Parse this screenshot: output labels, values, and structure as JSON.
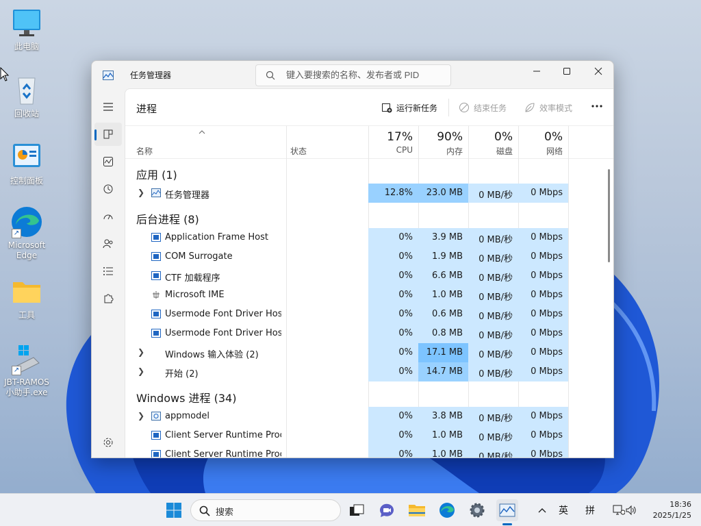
{
  "desktop": {
    "icons": [
      {
        "label": "此电脑"
      },
      {
        "label": "回收站"
      },
      {
        "label": "控制面板"
      },
      {
        "label": "Microsoft Edge"
      },
      {
        "label": "工具"
      },
      {
        "label": "JBT-RAMOS小助手.exe"
      }
    ]
  },
  "window": {
    "title": "任务管理器",
    "search_placeholder": "键入要搜索的名称、发布者或 PID",
    "page_title": "进程",
    "commands": {
      "run_new_task": "运行新任务",
      "end_task": "结束任务",
      "efficiency_mode": "效率模式"
    },
    "columns": {
      "name": "名称",
      "status": "状态",
      "cpu_pct": "17%",
      "cpu": "CPU",
      "mem_pct": "90%",
      "mem": "内存",
      "disk_pct": "0%",
      "disk": "磁盘",
      "net_pct": "0%",
      "net": "网络"
    },
    "groups": {
      "apps": "应用 (1)",
      "background": "后台进程 (8)",
      "windows": "Windows 进程 (34)"
    },
    "apps": [
      {
        "name": "任务管理器",
        "cpu": "12.8%",
        "mem": "23.0 MB",
        "disk": "0 MB/秒",
        "net": "0 Mbps"
      }
    ],
    "background": [
      {
        "name": "Application Frame Host",
        "cpu": "0%",
        "mem": "3.9 MB",
        "disk": "0 MB/秒",
        "net": "0 Mbps"
      },
      {
        "name": "COM Surrogate",
        "cpu": "0%",
        "mem": "1.9 MB",
        "disk": "0 MB/秒",
        "net": "0 Mbps"
      },
      {
        "name": "CTF 加载程序",
        "cpu": "0%",
        "mem": "6.6 MB",
        "disk": "0 MB/秒",
        "net": "0 Mbps"
      },
      {
        "name": "Microsoft IME",
        "cpu": "0%",
        "mem": "1.0 MB",
        "disk": "0 MB/秒",
        "net": "0 Mbps"
      },
      {
        "name": "Usermode Font Driver Host",
        "cpu": "0%",
        "mem": "0.6 MB",
        "disk": "0 MB/秒",
        "net": "0 Mbps"
      },
      {
        "name": "Usermode Font Driver Host",
        "cpu": "0%",
        "mem": "0.8 MB",
        "disk": "0 MB/秒",
        "net": "0 Mbps"
      },
      {
        "name": "Windows 输入体验 (2)",
        "cpu": "0%",
        "mem": "17.1 MB",
        "disk": "0 MB/秒",
        "net": "0 Mbps"
      },
      {
        "name": "开始 (2)",
        "cpu": "0%",
        "mem": "14.7 MB",
        "disk": "0 MB/秒",
        "net": "0 Mbps"
      }
    ],
    "windows_procs": [
      {
        "name": "appmodel",
        "cpu": "0%",
        "mem": "3.8 MB",
        "disk": "0 MB/秒",
        "net": "0 Mbps"
      },
      {
        "name": "Client Server Runtime Proc...",
        "cpu": "0%",
        "mem": "1.0 MB",
        "disk": "0 MB/秒",
        "net": "0 Mbps"
      },
      {
        "name": "Client Server Runtime Proc...",
        "cpu": "0%",
        "mem": "1.0 MB",
        "disk": "0 MB/秒",
        "net": "0 Mbps"
      }
    ]
  },
  "taskbar": {
    "search_label": "搜索",
    "ime_lang": "英",
    "ime_mode": "拼",
    "time": "18:36",
    "date": "2025/1/25"
  },
  "colors": {
    "accent": "#0067c0",
    "heat_light": "#cce8ff",
    "heat_medium": "#99d1ff",
    "heat_strong": "#7dc4ff"
  }
}
